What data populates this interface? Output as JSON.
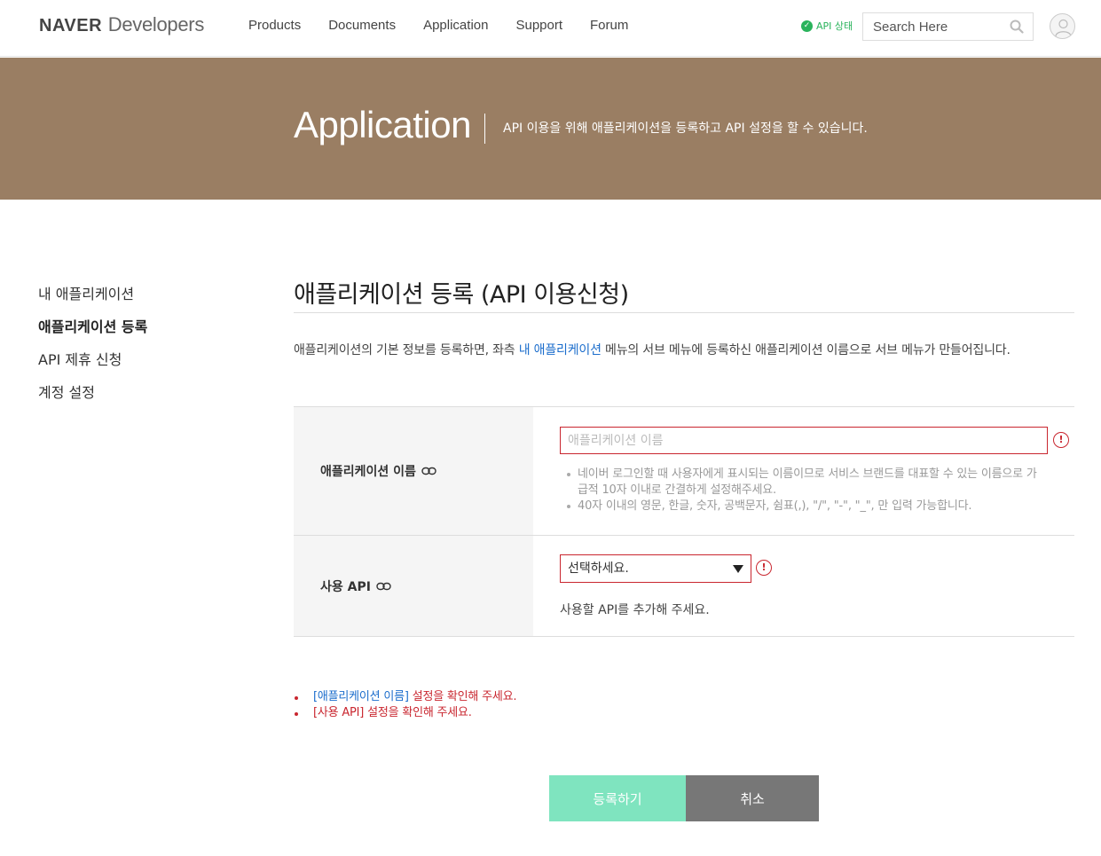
{
  "header": {
    "logo_bold": "NAVER",
    "logo_light": "Developers",
    "nav": [
      "Products",
      "Documents",
      "Application",
      "Support",
      "Forum"
    ],
    "api_status": "API 상태",
    "search_placeholder": "Search Here"
  },
  "hero": {
    "title": "Application",
    "description": "API 이용을 위해 애플리케이션을 등록하고 API 설정을 할 수 있습니다."
  },
  "sidebar": {
    "items": [
      {
        "label": "내 애플리케이션"
      },
      {
        "label": "애플리케이션 등록"
      },
      {
        "label": "API 제휴 신청"
      },
      {
        "label": "계정 설정"
      }
    ],
    "active_index": 1
  },
  "main": {
    "title": "애플리케이션 등록 (API 이용신청)",
    "intro_before": "애플리케이션의 기본 정보를 등록하면, 좌측 ",
    "intro_link": "내 애플리케이션",
    "intro_after": " 메뉴의 서브 메뉴에 등록하신 애플리케이션 이름으로 서브 메뉴가 만들어집니다."
  },
  "form": {
    "app_name": {
      "label": "애플리케이션 이름",
      "placeholder": "애플리케이션 이름",
      "value": "",
      "hints": [
        "네이버 로그인할 때 사용자에게 표시되는 이름이므로 서비스 브랜드를 대표할 수 있는 이름으로 가급적 10자 이내로 간결하게 설정해주세요.",
        "40자 이내의 영문, 한글, 숫자, 공백문자, 쉼표(,), \"/\", \"-\", \"_\", 만 입력 가능합니다."
      ]
    },
    "api": {
      "label": "사용 API",
      "selected": "선택하세요.",
      "note": "사용할 API를 추가해 주세요."
    }
  },
  "errors": [
    {
      "field": "[애플리케이션 이름]",
      "message": " 설정을 확인해 주세요."
    },
    {
      "field": "[사용 API]",
      "message": " 설정을 확인해 주세요."
    }
  ],
  "buttons": {
    "register": "등록하기",
    "cancel": "취소"
  },
  "colors": {
    "hero_bg": "#9a7e63",
    "error": "#c9262f",
    "link": "#1b6dcc",
    "register_btn": "#7fe4bf",
    "cancel_btn": "#777777",
    "status_green": "#2ab35c"
  }
}
